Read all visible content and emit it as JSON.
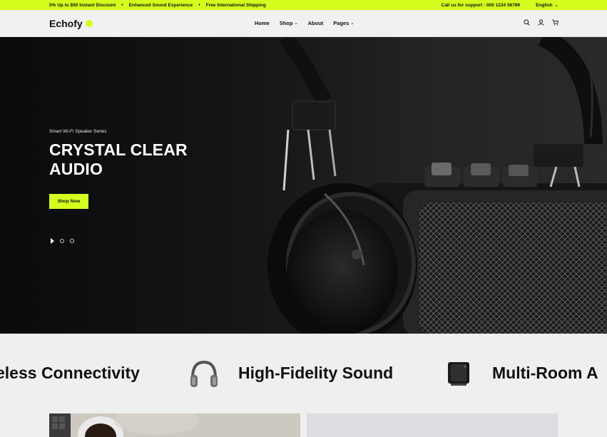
{
  "topbar": {
    "promo_1": "5% Up to $50 Instant Discount",
    "promo_2": "Enhanced Sound Experience",
    "promo_3": "Free International Shipping",
    "separator": "•",
    "support": "Call us for support :  000 1234 56789",
    "language": "English",
    "chevron": "⌄"
  },
  "header": {
    "logo": "Echofy",
    "nav": {
      "home": "Home",
      "shop": "Shop",
      "about": "About",
      "pages": "Pages",
      "chevron": "⌄"
    },
    "icons": [
      "search-icon",
      "user-icon",
      "cart-icon"
    ]
  },
  "hero": {
    "subtitle": "Smart Wi-Fi Speaker Series",
    "title_line1": "CRYSTAL CLEAR",
    "title_line2": "AUDIO",
    "cta": "Shop Now",
    "slides": 3,
    "active_slide": 1
  },
  "features": {
    "item1": "eless Connectivity",
    "item2": "High-Fidelity Sound",
    "item3": "Multi-Room A",
    "icons": [
      "headphones-icon",
      "speaker-icon"
    ]
  },
  "colors": {
    "accent": "#d4ff1e",
    "dark": "#111111",
    "background": "#efefef"
  }
}
